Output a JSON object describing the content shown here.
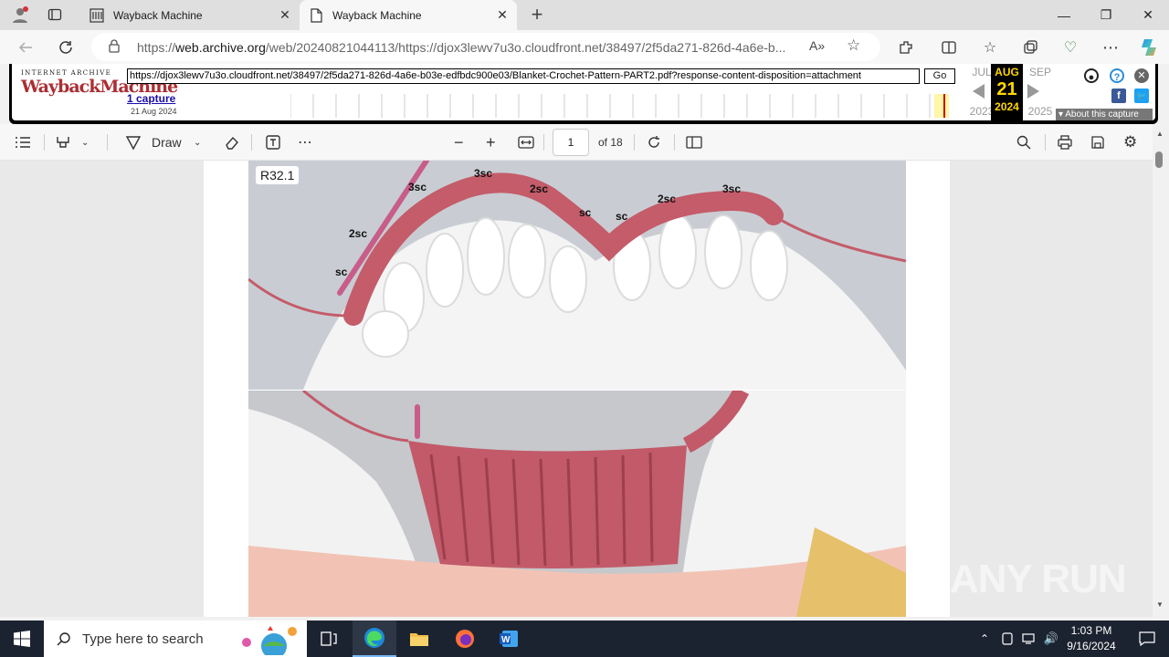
{
  "browser": {
    "tabs": [
      {
        "title": "Wayback Machine",
        "active": false
      },
      {
        "title": "Wayback Machine",
        "active": true
      }
    ],
    "new_tab_label": "+",
    "address": {
      "prefix": "https://",
      "host": "web.archive.org",
      "path": "/web/20240821044113/https://djox3lewv7u3o.cloudfront.net/38497/2f5da271-826d-4a6e-b..."
    }
  },
  "wayback": {
    "logo_top": "INTERNET ARCHIVE",
    "logo_main": "WaybackMachine",
    "url_value": "https://djox3lewv7u3o.cloudfront.net/38497/2f5da271-826d-4a6e-b03e-edfbdc900e03/Blanket-Crochet-Pattern-PART2.pdf?response-content-disposition=attachment",
    "go_label": "Go",
    "captures_label": "1 capture",
    "capture_date": "21 Aug 2024",
    "prev_month": "JUL",
    "cur_month": "AUG",
    "next_month": "SEP",
    "cur_day": "21",
    "prev_year": "2023",
    "cur_year": "2024",
    "next_year": "2025",
    "about_label": "About this capture"
  },
  "pdf_toolbar": {
    "draw_label": "Draw",
    "page_value": "1",
    "page_total": "of 18"
  },
  "document": {
    "row_label": "R32.1",
    "stitch_labels": [
      "sc",
      "2sc",
      "3sc",
      "3sc",
      "2sc",
      "sc",
      "sc",
      "2sc",
      "3sc"
    ]
  },
  "watermark": "ANY RUN",
  "taskbar": {
    "search_placeholder": "Type here to search",
    "time": "1:03 PM",
    "date": "9/16/2024"
  }
}
